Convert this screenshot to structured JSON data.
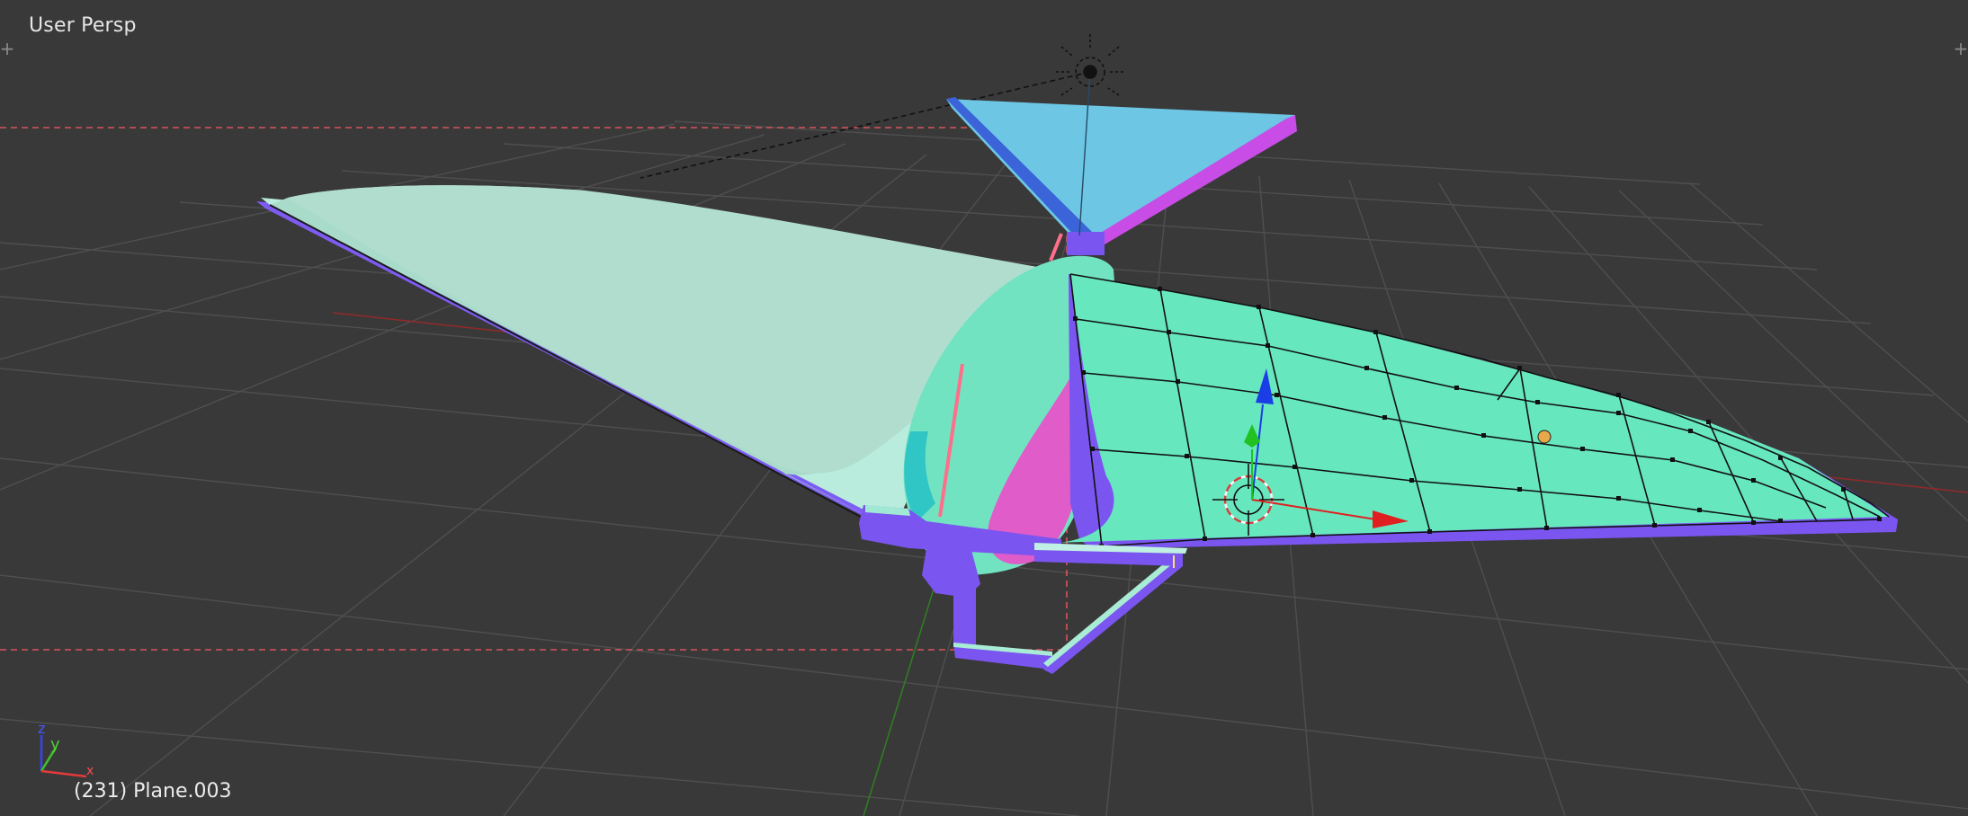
{
  "viewport": {
    "view_label": "User Persp",
    "object_info": "(231) Plane.003",
    "split_handle_left": "+",
    "split_handle_right": "+"
  },
  "axis_widget": {
    "z": "z",
    "y": "y",
    "x": "x"
  },
  "colors": {
    "background": "#393939",
    "grid": "#4e4e4e",
    "axis_x": "#9c2a2a",
    "axis_y": "#3e8f2a",
    "camera_frame": "#d9535f",
    "mesh_top": "#68e8bd",
    "mesh_edge": "#7b55f0",
    "tail_fin": "#6cc6e4",
    "wing_left": "#a8dcc8",
    "manipulator_x": "#e02020",
    "manipulator_y": "#22c122",
    "manipulator_z": "#1a3de6",
    "origin_dot": "#e8a84a"
  }
}
